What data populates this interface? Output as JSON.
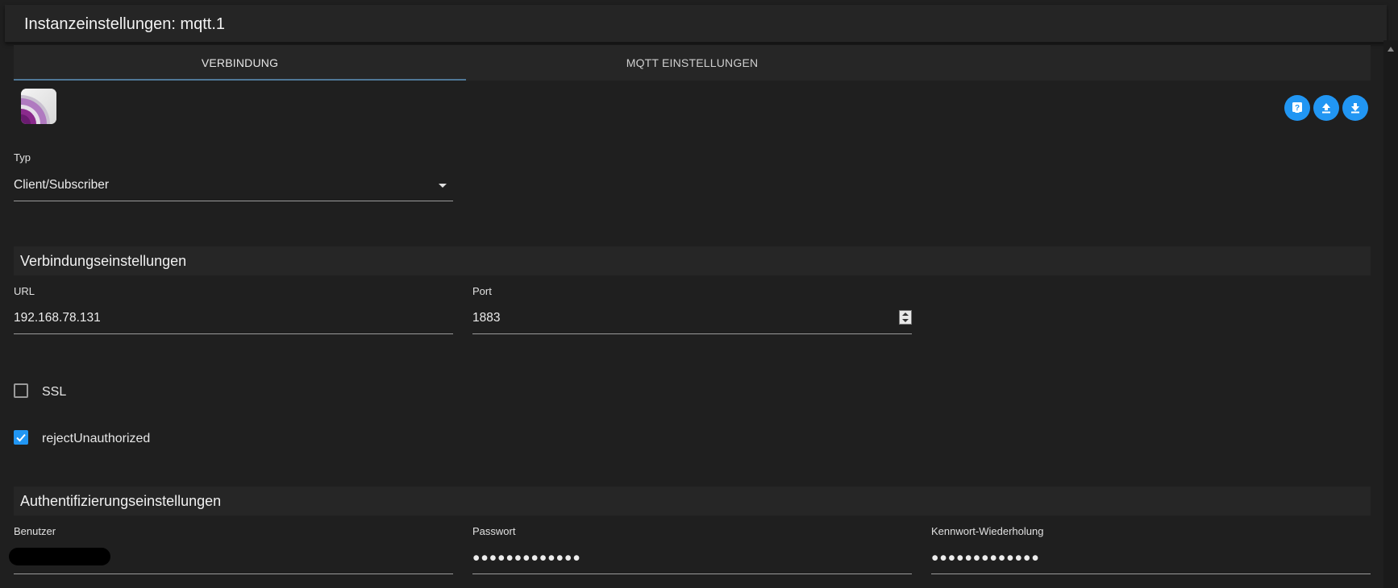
{
  "window": {
    "title": "Instanzeinstellungen: mqtt.1"
  },
  "tabs": [
    {
      "label": "VERBINDUNG",
      "active": true
    },
    {
      "label": "MQTT EINSTELLUNGEN",
      "active": false
    }
  ],
  "logo": {
    "icon": "mqtt-logo-icon"
  },
  "toolbar": {
    "buttons": [
      {
        "icon": "help-icon"
      },
      {
        "icon": "upload-icon"
      },
      {
        "icon": "download-icon"
      }
    ],
    "accent_color": "#2196f3"
  },
  "type_select": {
    "label": "Typ",
    "value": "Client/Subscriber"
  },
  "connection_section": {
    "title": "Verbindungseinstellungen",
    "url": {
      "label": "URL",
      "value": "192.168.78.131"
    },
    "port": {
      "label": "Port",
      "value": "1883"
    },
    "ssl": {
      "label": "SSL",
      "checked": false
    },
    "reject_unauthorized": {
      "label": "rejectUnauthorized",
      "checked": true
    }
  },
  "auth_section": {
    "title": "Authentifizierungseinstellungen",
    "user": {
      "label": "Benutzer",
      "value": ""
    },
    "password": {
      "label": "Passwort",
      "value": "●●●●●●●●●●●●●"
    },
    "password_repeat": {
      "label": "Kennwort-Wiederholung",
      "value": "●●●●●●●●●●●●●"
    }
  }
}
